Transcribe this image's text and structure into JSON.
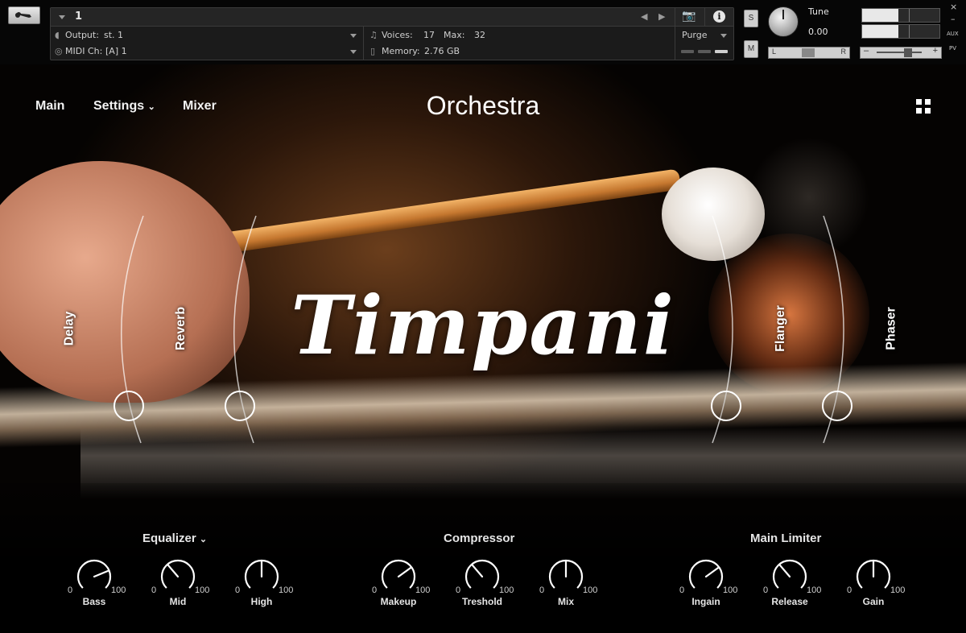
{
  "kontakt": {
    "instrument_name": "1",
    "output_label": "Output:",
    "output_value": "st. 1",
    "midi_label": "MIDI Ch:",
    "midi_value": "[A]  1",
    "voices_label": "Voices:",
    "voices_value": "17",
    "max_label": "Max:",
    "max_value": "32",
    "memory_label": "Memory:",
    "memory_value": "2.76 GB",
    "purge_label": "Purge",
    "solo_label": "S",
    "mute_label": "M",
    "tune_label": "Tune",
    "tune_value": "0.00",
    "pan_left": "L",
    "pan_right": "R",
    "aux_label": "AUX",
    "pv_label": "PV",
    "close_label": "×",
    "minimize_label": "–",
    "vol_minus": "–",
    "vol_plus": "+"
  },
  "nav": {
    "main": "Main",
    "settings": "Settings",
    "mixer": "Mixer"
  },
  "brand": "Orchestra",
  "instrument_title": "Timpani",
  "effects": {
    "delay": "Delay",
    "reverb": "Reverb",
    "flanger": "Flanger",
    "phaser": "Phaser"
  },
  "sections": {
    "equalizer": "Equalizer",
    "compressor": "Compressor",
    "limiter": "Main Limiter"
  },
  "knobs": [
    {
      "name": "Bass",
      "min": "0",
      "max": "100",
      "value": 75
    },
    {
      "name": "Mid",
      "min": "0",
      "max": "100",
      "value": 35
    },
    {
      "name": "High",
      "min": "0",
      "max": "100",
      "value": 50
    },
    {
      "name": "Makeup",
      "min": "0",
      "max": "100",
      "value": 70
    },
    {
      "name": "Treshold",
      "min": "0",
      "max": "100",
      "value": 35
    },
    {
      "name": "Mix",
      "min": "0",
      "max": "100",
      "value": 50
    },
    {
      "name": "Ingain",
      "min": "0",
      "max": "100",
      "value": 70
    },
    {
      "name": "Release",
      "min": "0",
      "max": "100",
      "value": 35
    },
    {
      "name": "Gain",
      "min": "0",
      "max": "100",
      "value": 50
    }
  ]
}
